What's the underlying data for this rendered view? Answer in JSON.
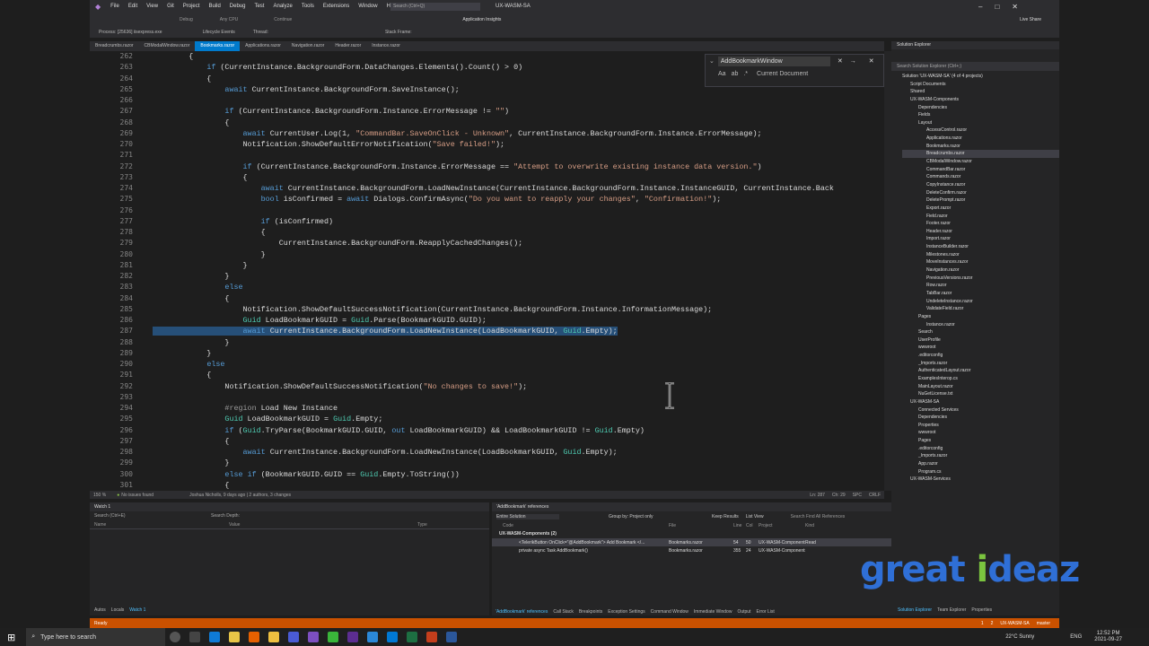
{
  "menu": [
    "File",
    "Edit",
    "View",
    "Git",
    "Project",
    "Build",
    "Debug",
    "Test",
    "Analyze",
    "Tools",
    "Extensions",
    "Window",
    "Help"
  ],
  "search_placeholder": "Search (Ctrl+Q)",
  "window_title": "UX-WASM-SA",
  "toolbar": {
    "debug": "Debug",
    "any_cpu": "Any CPU",
    "continue": "Continue",
    "app_insights": "Application Insights",
    "live_share": "Live Share"
  },
  "toolbar2": {
    "process": "Process: [25636] iisexpress.exe",
    "lifecycle": "Lifecycle Events",
    "thread": "Thread:",
    "stack_frame": "Stack Frame:"
  },
  "tabs": [
    "Breadcrumbs.razor",
    "CBModalWindow.razor",
    "Bookmarks.razor",
    "Applications.razor",
    "Navigation.razor",
    "Header.razor",
    "Instance.razor"
  ],
  "active_tab": "Bookmarks.razor",
  "line_numbers": [
    "262",
    "263",
    "264",
    "265",
    "266",
    "267",
    "268",
    "269",
    "270",
    "271",
    "272",
    "273",
    "274",
    "275",
    "276",
    "277",
    "278",
    "279",
    "280",
    "281",
    "282",
    "283",
    "284",
    "285",
    "286",
    "287",
    "288",
    "289",
    "290",
    "291",
    "292",
    "293",
    "294",
    "295",
    "296",
    "297",
    "298",
    "299",
    "300",
    "301"
  ],
  "code": [
    "        {",
    "            if (CurrentInstance.BackgroundForm.DataChanges.Elements().Count() > 0)",
    "            {",
    "                await CurrentInstance.BackgroundForm.SaveInstance();",
    "",
    "                if (CurrentInstance.BackgroundForm.Instance.ErrorMessage != \"\")",
    "                {",
    "                    await CurrentUser.Log(1, \"CommandBar.SaveOnClick - Unknown\", CurrentInstance.BackgroundForm.Instance.ErrorMessage);",
    "                    Notification.ShowDefaultErrorNotification(\"Save failed!\");",
    "",
    "                    if (CurrentInstance.BackgroundForm.Instance.ErrorMessage == \"Attempt to overwrite existing instance data version.\")",
    "                    {",
    "                        await CurrentInstance.BackgroundForm.LoadNewInstance(CurrentInstance.BackgroundForm.Instance.InstanceGUID, CurrentInstance.Back",
    "                        bool isConfirmed = await Dialogs.ConfirmAsync(\"Do you want to reapply your changes\", \"Confirmation!\");",
    "",
    "                        if (isConfirmed)",
    "                        {",
    "                            CurrentInstance.BackgroundForm.ReapplyCachedChanges();",
    "                        }",
    "                    }",
    "                }",
    "                else",
    "                {",
    "                    Notification.ShowDefaultSuccessNotification(CurrentInstance.BackgroundForm.Instance.InformationMessage);",
    "                    Guid LoadBookmarkGUID = Guid.Parse(BookmarkGUID.GUID);",
    "                    await CurrentInstance.BackgroundForm.LoadNewInstance(LoadBookmarkGUID, Guid.Empty);",
    "                }",
    "            }",
    "            else",
    "            {",
    "                Notification.ShowDefaultSuccessNotification(\"No changes to save!\");",
    "",
    "                #region Load New Instance",
    "                Guid LoadBookmarkGUID = Guid.Empty;",
    "                if (Guid.TryParse(BookmarkGUID.GUID, out LoadBookmarkGUID) && LoadBookmarkGUID != Guid.Empty)",
    "                {",
    "                    await CurrentInstance.BackgroundForm.LoadNewInstance(LoadBookmarkGUID, Guid.Empty);",
    "                }",
    "                else if (BookmarkGUID.GUID == Guid.Empty.ToString())",
    "                {"
  ],
  "find": {
    "query": "AddBookmarkWindow",
    "scope": "Current Document"
  },
  "editor_status": {
    "zoom": "150 %",
    "issues": "No issues found",
    "git": "Joshua Nicholls, 9 days ago | 2 authors, 3 changes",
    "ln": "Ln: 287",
    "ch": "Ch: 29",
    "spc": "SPC",
    "crlf": "CRLF"
  },
  "solution": {
    "title": "Solution Explorer",
    "search": "Search Solution Explorer (Ctrl+;)",
    "items": [
      "Solution 'UX-WASM-SA' (4 of 4 projects)",
      "Script Documents",
      "Shared",
      "UX-WASM-Components",
      "Dependencies",
      "Fields",
      "Layout",
      "AccessControl.razor",
      "Applications.razor",
      "Bookmarks.razor",
      "Breadcrumbs.razor",
      "CBModalWindow.razor",
      "CommandBar.razor",
      "Commands.razor",
      "CopyInstance.razor",
      "DeleteConfirm.razor",
      "DeletePrompt.razor",
      "Export.razor",
      "Field.razor",
      "Footer.razor",
      "Header.razor",
      "Import.razor",
      "InstanceBuilder.razor",
      "Milestones.razor",
      "MoveInstances.razor",
      "Navigation.razor",
      "PreviousVersions.razor",
      "Row.razor",
      "TabBar.razor",
      "UndeleteInstance.razor",
      "ValidateField.razor",
      "Pages",
      "Instance.razor",
      "Search",
      "UserProfile",
      "wwwroot",
      ".editorconfig",
      "_Imports.razor",
      "AuthenticatedLayout.razor",
      "ExamplesInterop.cs",
      "MainLayout.razor",
      "NuGetLicense.txt",
      "UX-WASM-SA",
      "Connected Services",
      "Dependencies",
      "Properties",
      "wwwroot",
      "Pages",
      ".editorconfig",
      "_Imports.razor",
      "App.razor",
      "Program.cs",
      "UX-WASM-Services"
    ],
    "indent": [
      0,
      1,
      1,
      1,
      2,
      2,
      2,
      3,
      3,
      3,
      3,
      3,
      3,
      3,
      3,
      3,
      3,
      3,
      3,
      3,
      3,
      3,
      3,
      3,
      3,
      3,
      3,
      3,
      3,
      3,
      3,
      2,
      3,
      2,
      2,
      2,
      2,
      2,
      2,
      2,
      2,
      2,
      1,
      2,
      2,
      2,
      2,
      2,
      2,
      2,
      2,
      2,
      1
    ]
  },
  "watch": {
    "title": "Watch 1",
    "search": "Search (Ctrl+E)",
    "depth": "Search Depth:",
    "cols": [
      "Name",
      "Value",
      "Type"
    ],
    "tabs": [
      "Autos",
      "Locals",
      "Watch 1"
    ]
  },
  "refs": {
    "title": "'AddBookmark' references",
    "scope": "Entire Solution",
    "group": "Group by: Project only",
    "keep": "Keep Results",
    "list": "List View",
    "find": "Search Find All References",
    "cols": [
      "Code",
      "File",
      "Line",
      "Col",
      "Project",
      "Kind"
    ],
    "group_row": "UX-WASM-Components (2)",
    "rows": [
      [
        "<TelerikButton OnClick=\"@AddBookmark\"> Add Bookmark </...",
        "Bookmarks.razor",
        "54",
        "50",
        "UX-WASM-Components",
        "Read"
      ],
      [
        "private async Task AddBookmark()",
        "Bookmarks.razor",
        "355",
        "24",
        "UX-WASM-Components",
        ""
      ]
    ]
  },
  "bottom_tabs": [
    "'AddBookmark' references",
    "Call Stack",
    "Breakpoints",
    "Exception Settings",
    "Command Window",
    "Immediate Window",
    "Output",
    "Error List"
  ],
  "sol_tabs": [
    "Solution Explorer",
    "Team Explorer",
    "Properties"
  ],
  "status": {
    "ready": "Ready",
    "errors": "1",
    "warnings": "2",
    "project": "UX-WASM-SA",
    "branch": "master"
  },
  "taskbar": {
    "search": "Type here to search",
    "weather": "22°C  Sunny",
    "lang": "ENG",
    "time": "12:52 PM",
    "date": "2021-09-27"
  },
  "logo": {
    "a": "great",
    "b": "i",
    "c": "deaz"
  }
}
